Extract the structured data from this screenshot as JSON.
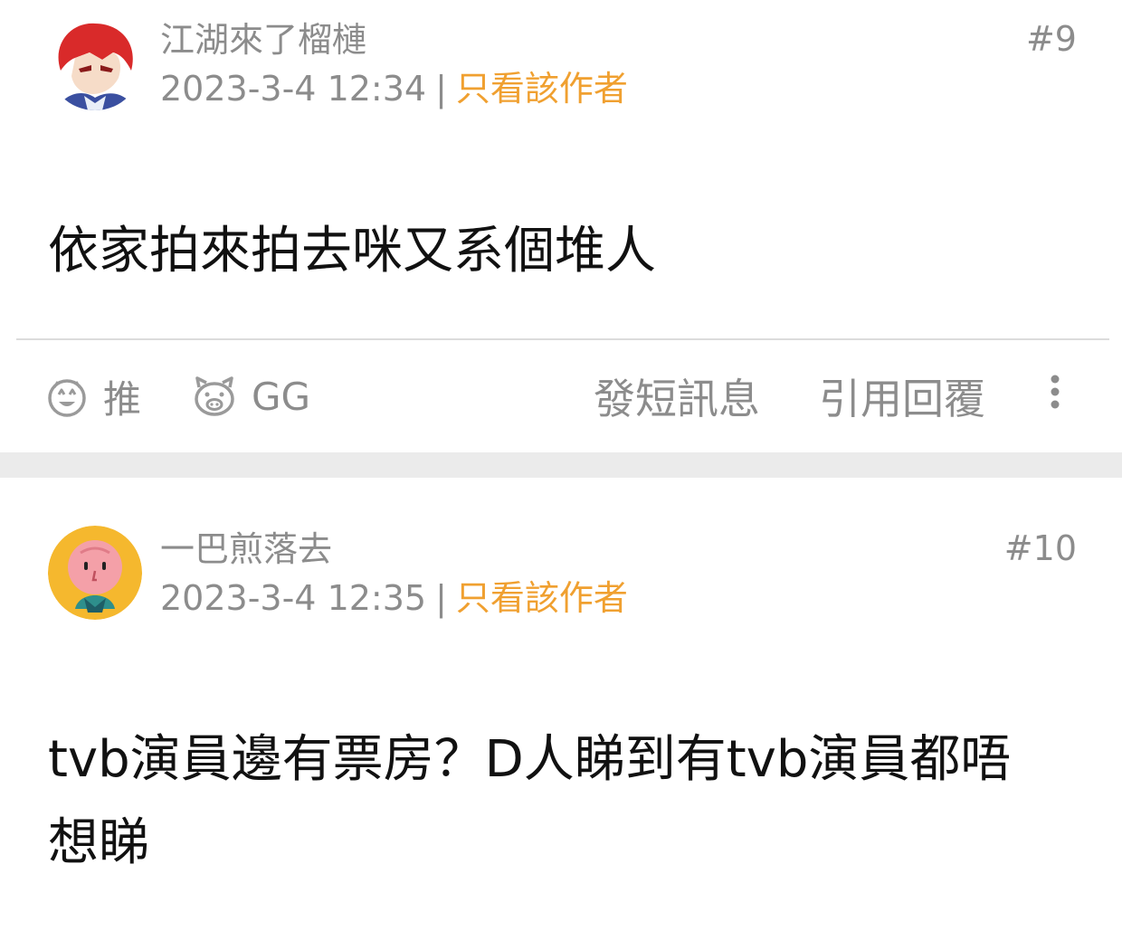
{
  "posts": [
    {
      "username": "江湖來了榴槤",
      "timestamp": "2023-3-4 12:34",
      "separator": "|",
      "author_only_label": "只看該作者",
      "floor": "#9",
      "content": "依家拍來拍去咪又系個堆人",
      "actions": {
        "push_label": "推",
        "gg_label": "GG",
        "pm_label": "發短訊息",
        "quote_label": "引用回覆"
      },
      "icons": {
        "push": "smiley-face-icon",
        "gg": "pig-face-icon",
        "more": "more-vertical-icon"
      }
    },
    {
      "username": "一巴煎落去",
      "timestamp": "2023-3-4 12:35",
      "separator": "|",
      "author_only_label": "只看該作者",
      "floor": "#10",
      "content": "tvb演員邊有票房？D人睇到有tvb演員都唔想睇"
    }
  ],
  "colors": {
    "accent": "#f0a030",
    "meta_text": "#8c8c8c",
    "body_text": "#111111",
    "section_separator": "#ebebeb",
    "divider": "#dcdcdc"
  }
}
